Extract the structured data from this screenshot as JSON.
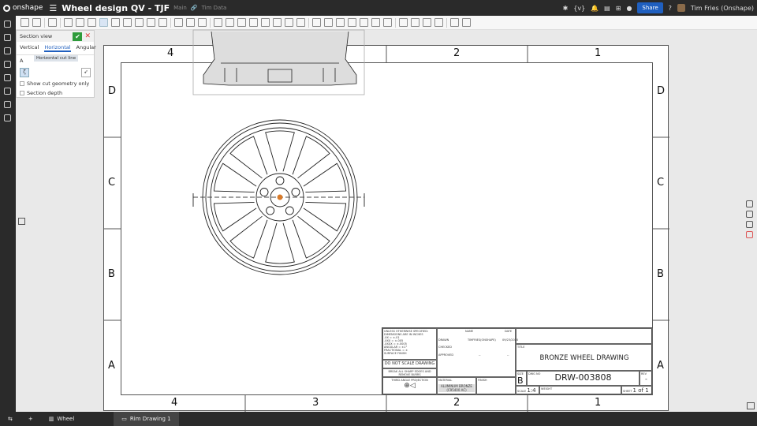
{
  "app": {
    "brand": "onshape",
    "title": "Wheel design QV - TJF",
    "branch": "Main",
    "folder": "Tim Data"
  },
  "header": {
    "share": "Share",
    "user": "Tim Fries (Onshape)",
    "help": "?"
  },
  "panel": {
    "title": "Section view",
    "tabs": [
      "Vertical",
      "Horizontal",
      "Angular"
    ],
    "active_tab": "Horizontal",
    "field_label": "A",
    "tooltip": "Horizontal cut line",
    "options": [
      "Show cut geometry only",
      "Section depth"
    ]
  },
  "sheet": {
    "columns": [
      "4",
      "3",
      "2",
      "1"
    ],
    "rows": [
      "D",
      "C",
      "B",
      "A"
    ]
  },
  "title_block": {
    "tolerance": "UNLESS OTHERWISE SPECIFIED: DIMENSIONS ARE IN INCHES",
    "tol_lines": [
      ".XX = ±.01",
      ".XXX = ±.005",
      ".XXXX = ±.0005",
      "ANGULAR = ±1°",
      "FRACTIONAL = ±"
    ],
    "surface": "SURFACE FINISH",
    "no_scale": "DO NOT SCALE DRAWING",
    "break_edges": "BREAK ALL SHARP EDGES AND REMOVE BURRS",
    "projection": "THIRD ANGLE PROJECTION",
    "headers": {
      "name": "NAME",
      "date": "DATE"
    },
    "drawn": "DRAWN",
    "drawn_name": "TIMFRIES(ONSHAPE)",
    "drawn_date": "09/23/2020",
    "checked": "CHECKED",
    "approved": "APPROVED",
    "dash": "--",
    "material_label": "MATERIAL",
    "material": "ALUMINUM BRONZE (C95400 AC)",
    "finish_label": "FINISH",
    "title_label": "TITLE",
    "title": "BRONZE WHEEL DRAWING",
    "size_label": "SIZE",
    "size": "B",
    "dwg_label": "DWG NO",
    "dwg_no": "DRW-003808",
    "rev_label": "REV",
    "rev": "-",
    "scale_label": "SCALE",
    "scale": "1:4",
    "weight_label": "WEIGHT",
    "sheet_label": "SHEET",
    "sheet": "1 of 1"
  },
  "tabs": [
    {
      "label": "Wheel"
    },
    {
      "label": "Rim Drawing 1"
    }
  ],
  "colors": {
    "accent": "#1f5fbf",
    "ok": "#2e9b3b",
    "topbar": "#2a2a2a"
  }
}
